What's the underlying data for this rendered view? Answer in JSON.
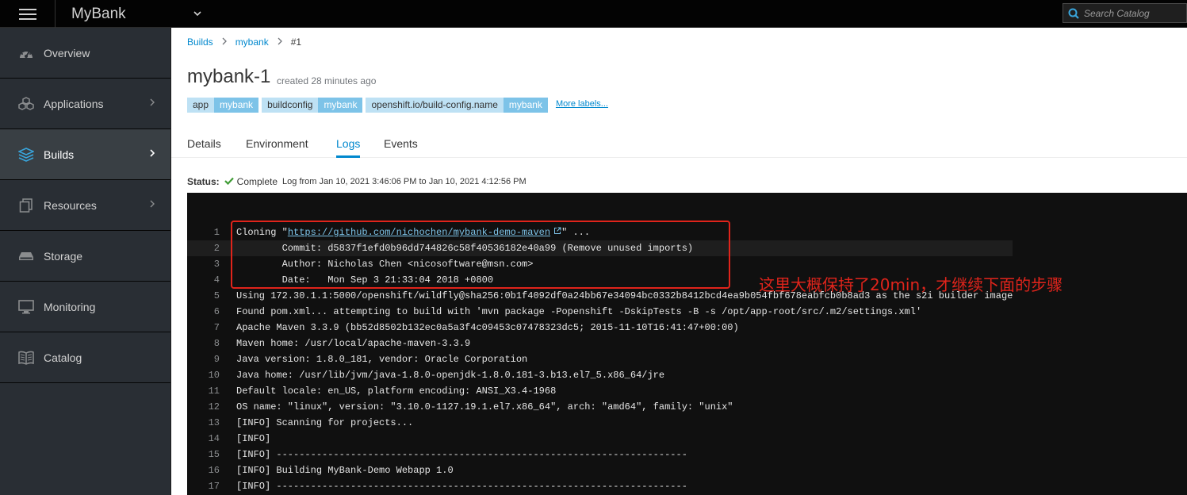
{
  "topbar": {
    "app_title": "MyBank",
    "search_placeholder": "Search Catalog"
  },
  "sidebar": {
    "items": [
      {
        "label": "Overview",
        "icon": "dashboard-icon",
        "chevron": false,
        "active": false
      },
      {
        "label": "Applications",
        "icon": "cubes-icon",
        "chevron": true,
        "active": false
      },
      {
        "label": "Builds",
        "icon": "layers-icon",
        "chevron": true,
        "active": true
      },
      {
        "label": "Resources",
        "icon": "files-icon",
        "chevron": true,
        "active": false
      },
      {
        "label": "Storage",
        "icon": "storage-icon",
        "chevron": false,
        "active": false
      },
      {
        "label": "Monitoring",
        "icon": "monitor-icon",
        "chevron": false,
        "active": false
      },
      {
        "label": "Catalog",
        "icon": "book-icon",
        "chevron": false,
        "active": false
      }
    ]
  },
  "breadcrumb": {
    "builds": "Builds",
    "config": "mybank",
    "current": "#1"
  },
  "page": {
    "title": "mybank-1",
    "created": "created 28 minutes ago"
  },
  "labels": [
    {
      "key": "app",
      "value": "mybank"
    },
    {
      "key": "buildconfig",
      "value": "mybank"
    },
    {
      "key": "openshift.io/build-config.name",
      "value": "mybank"
    }
  ],
  "more_labels": "More labels...",
  "tabs": [
    "Details",
    "Environment",
    "Logs",
    "Events"
  ],
  "active_tab": "Logs",
  "status": {
    "label": "Status:",
    "value": "Complete",
    "log_range": "Log from Jan 10, 2021 3:46:06 PM to Jan 10, 2021 4:12:56 PM"
  },
  "log": {
    "cloning_prefix": "Cloning \"",
    "cloning_url": "https://github.com/nichochen/mybank-demo-maven",
    "cloning_suffix": "\" ...",
    "lines": [
      "        Commit: d5837f1efd0b96dd744826c58f40536182e40a99 (Remove unused imports)",
      "        Author: Nicholas Chen <nicosoftware@msn.com>",
      "        Date:   Mon Sep 3 21:33:04 2018 +0800",
      "Using 172.30.1.1:5000/openshift/wildfly@sha256:0b1f4092df0a24bb67e34094bc0332b8412bcd4ea9b054fbf678eabfcb0b8ad3 as the s2i builder image",
      "Found pom.xml... attempting to build with 'mvn package -Popenshift -DskipTests -B -s /opt/app-root/src/.m2/settings.xml'",
      "Apache Maven 3.3.9 (bb52d8502b132ec0a5a3f4c09453c07478323dc5; 2015-11-10T16:41:47+00:00)",
      "Maven home: /usr/local/apache-maven-3.3.9",
      "Java version: 1.8.0_181, vendor: Oracle Corporation",
      "Java home: /usr/lib/jvm/java-1.8.0-openjdk-1.8.0.181-3.b13.el7_5.x86_64/jre",
      "Default locale: en_US, platform encoding: ANSI_X3.4-1968",
      "OS name: \"linux\", version: \"3.10.0-1127.19.1.el7.x86_64\", arch: \"amd64\", family: \"unix\"",
      "[INFO] Scanning for projects...",
      "[INFO]",
      "[INFO] ------------------------------------------------------------------------",
      "[INFO] Building MyBank-Demo Webapp 1.0",
      "[INFO] ------------------------------------------------------------------------"
    ],
    "highlighted_line": 2
  },
  "annotation": "这里大概保持了20min，才继续下面的步骤",
  "colors": {
    "accent": "#0088ce",
    "annotation": "#e0241b",
    "success": "#3f9c35"
  }
}
